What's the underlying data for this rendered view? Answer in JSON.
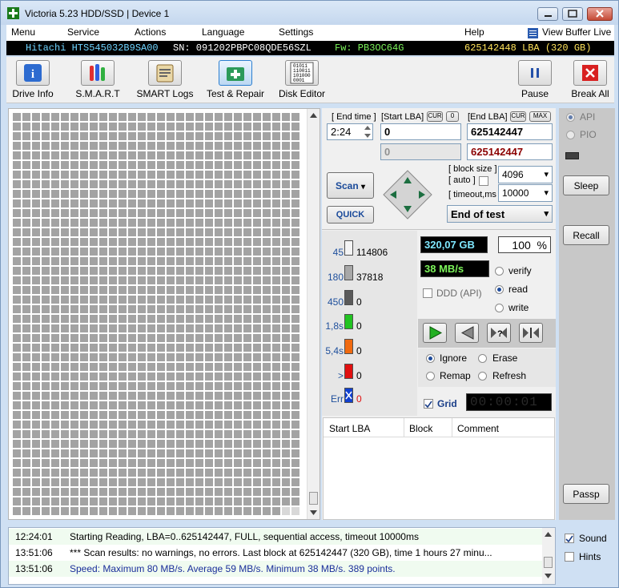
{
  "window": {
    "title": "Victoria 5.23 HDD/SSD | Device 1"
  },
  "menu": {
    "items": [
      "Menu",
      "Service",
      "Actions",
      "Language",
      "Settings"
    ],
    "help": "Help",
    "view_buffer": "View Buffer Live"
  },
  "drive": {
    "model": "Hitachi HTS545032B9SA00",
    "serial": "SN: 091202PBPC08QDE56SZL",
    "firmware": "Fw: PB3OC64G",
    "capacity": "625142448 LBA (320 GB)"
  },
  "toolbar": {
    "drive_info": "Drive Info",
    "smart": "S.M.A.R.T",
    "smart_logs": "SMART Logs",
    "test_repair": "Test & Repair",
    "disk_editor": "Disk Editor",
    "pause": "Pause",
    "break_all": "Break All",
    "disk_editor_bits": [
      "01011",
      "110011",
      "101000",
      "0001"
    ]
  },
  "scan": {
    "end_time_label": "[ End time ]",
    "end_time_value": "2:24",
    "start_lba_label": "[Start LBA]",
    "start_cur": "CUR",
    "start_zero": "0",
    "start_lba_value": "0",
    "start_lba_current": "0",
    "end_lba_label": "[End LBA]",
    "end_cur": "CUR",
    "end_max": "MAX",
    "end_lba_value": "625142447",
    "end_lba_current": "625142447",
    "scan_button": "Scan",
    "quick_button": "QUICK",
    "block_size_label": "[ block size ]",
    "auto_label": "[ auto ]",
    "block_size_value": "4096",
    "timeout_label": "[ timeout,ms ]",
    "timeout_value": "10000",
    "end_action": "End of test"
  },
  "blocks": [
    {
      "label": "45",
      "count": "114806",
      "color": "#f4f4f4"
    },
    {
      "label": "180",
      "count": "37818",
      "color": "#a8a8a8"
    },
    {
      "label": "450",
      "count": "0",
      "color": "#5a5a5a"
    },
    {
      "label": "1,8s",
      "count": "0",
      "color": "#22c322"
    },
    {
      "label": "5,4s",
      "count": "0",
      "color": "#f06a10"
    },
    {
      "label": ">",
      "count": "0",
      "color": "#e01010"
    },
    {
      "label": "Err",
      "count": "0",
      "color": "#1040d0"
    }
  ],
  "stats": {
    "scanned": "320,07 GB",
    "percent": "100",
    "percent_unit": "%",
    "speed": "38 MB/s",
    "ddd": "DDD (API)",
    "verify": "verify",
    "read": "read",
    "write": "write",
    "grid": "Grid",
    "timer": "00:00:01"
  },
  "mode": {
    "ignore": "Ignore",
    "erase": "Erase",
    "remap": "Remap",
    "refresh": "Refresh"
  },
  "table": {
    "columns": [
      "Start LBA",
      "Block",
      "Comment"
    ]
  },
  "right": {
    "api": "API",
    "pio": "PIO",
    "sleep": "Sleep",
    "recall": "Recall",
    "passp": "Passp"
  },
  "log": [
    {
      "time": "12:24:01",
      "text": "Starting Reading, LBA=0..625142447, FULL, sequential access, timeout 10000ms",
      "color": "#000000"
    },
    {
      "time": "13:51:06",
      "text": "*** Scan results: no warnings, no errors. Last block at 625142447 (320 GB), time 1 hours 27 minu...",
      "color": "#000000"
    },
    {
      "time": "13:51:06",
      "text": "Speed: Maximum 80 MB/s. Average 59 MB/s. Minimum 38 MB/s. 389 points.",
      "color": "#1a2f9a"
    }
  ],
  "options": {
    "sound": "Sound",
    "hints": "Hints"
  },
  "colors": {
    "model": "#6fd4ff",
    "serial": "#ffffff",
    "firmware": "#7cf45a",
    "capacity": "#ffe35a",
    "lba_current": "#8b0000"
  }
}
